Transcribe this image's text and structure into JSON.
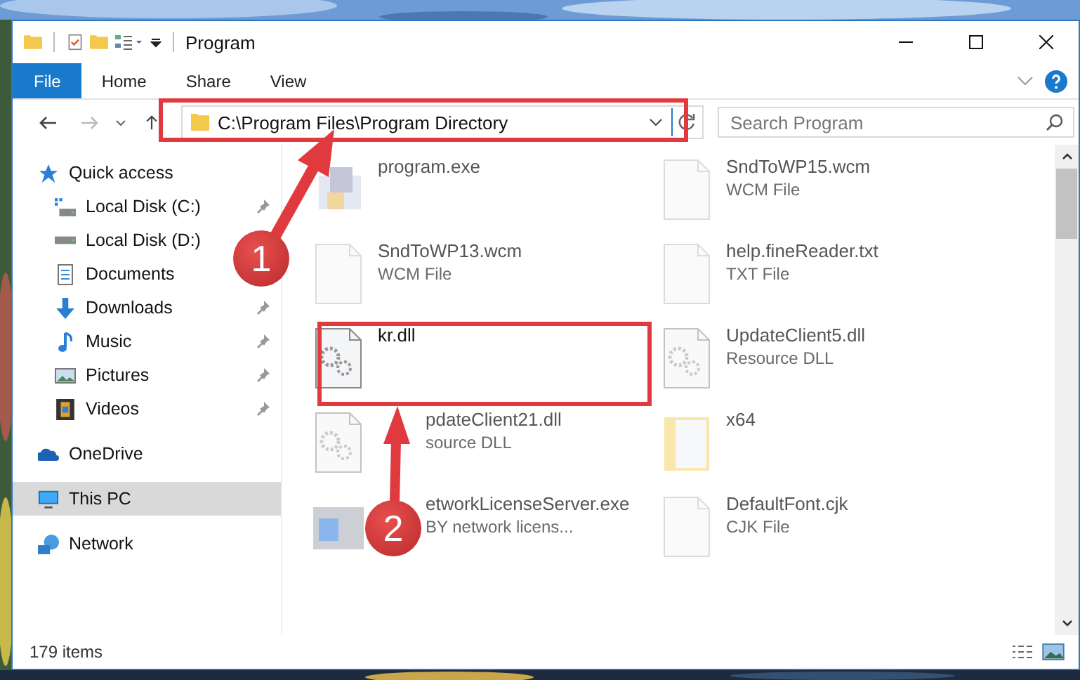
{
  "window": {
    "title": "Program"
  },
  "ribbon_tabs": [
    {
      "label": "File",
      "kind": "file"
    },
    {
      "label": "Home",
      "kind": "tab"
    },
    {
      "label": "Share",
      "kind": "tab"
    },
    {
      "label": "View",
      "kind": "tab"
    }
  ],
  "address": {
    "path": "C:\\Program Files\\Program Directory"
  },
  "search": {
    "placeholder": "Search Program"
  },
  "nav": [
    {
      "label": "Quick access",
      "kind": "quick",
      "selected": false,
      "children": [
        {
          "label": "Local Disk (C:)",
          "kind": "drive-c",
          "pinned": true
        },
        {
          "label": "Local Disk (D:)",
          "kind": "drive",
          "pinned": false
        },
        {
          "label": "Documents",
          "kind": "documents",
          "pinned": false
        },
        {
          "label": "Downloads",
          "kind": "downloads",
          "pinned": true
        },
        {
          "label": "Music",
          "kind": "music",
          "pinned": true
        },
        {
          "label": "Pictures",
          "kind": "pictures",
          "pinned": true
        },
        {
          "label": "Videos",
          "kind": "videos",
          "pinned": true
        }
      ]
    },
    {
      "label": "OneDrive",
      "kind": "cloud",
      "selected": false
    },
    {
      "label": "This PC",
      "kind": "pc",
      "selected": true
    },
    {
      "label": "Network",
      "kind": "network",
      "selected": false
    }
  ],
  "files": [
    {
      "name": "program.exe",
      "kind": "exe",
      "dimmed": true
    },
    {
      "name": "SndToWP15.wcm",
      "type": "WCM File",
      "kind": "file",
      "dimmed": true
    },
    {
      "name": "SndToWP13.wcm",
      "type": "WCM File",
      "kind": "file",
      "dimmed": true
    },
    {
      "name": "help.fineReader.txt",
      "type": "TXT File",
      "kind": "file",
      "dimmed": true
    },
    {
      "name": "kr.dll",
      "kind": "dll",
      "dimmed": false
    },
    {
      "name": "UpdateClient5.dll",
      "type": "Resource DLL",
      "kind": "dll",
      "dimmed": true
    },
    {
      "name": "pdateClient21.dll",
      "type": "source DLL",
      "kind": "dll",
      "dimmed": true,
      "covered": true
    },
    {
      "name": "x64",
      "kind": "folder",
      "dimmed": true
    },
    {
      "name": "etworkLicenseServer.exe",
      "type": "BY network licens...",
      "kind": "app",
      "dimmed": true,
      "covered": true
    },
    {
      "name": "DefaultFont.cjk",
      "type": "CJK File",
      "kind": "file",
      "dimmed": true
    }
  ],
  "status_bar": {
    "count": "179 items"
  },
  "annotations": [
    {
      "number": "1"
    },
    {
      "number": "2"
    }
  ]
}
